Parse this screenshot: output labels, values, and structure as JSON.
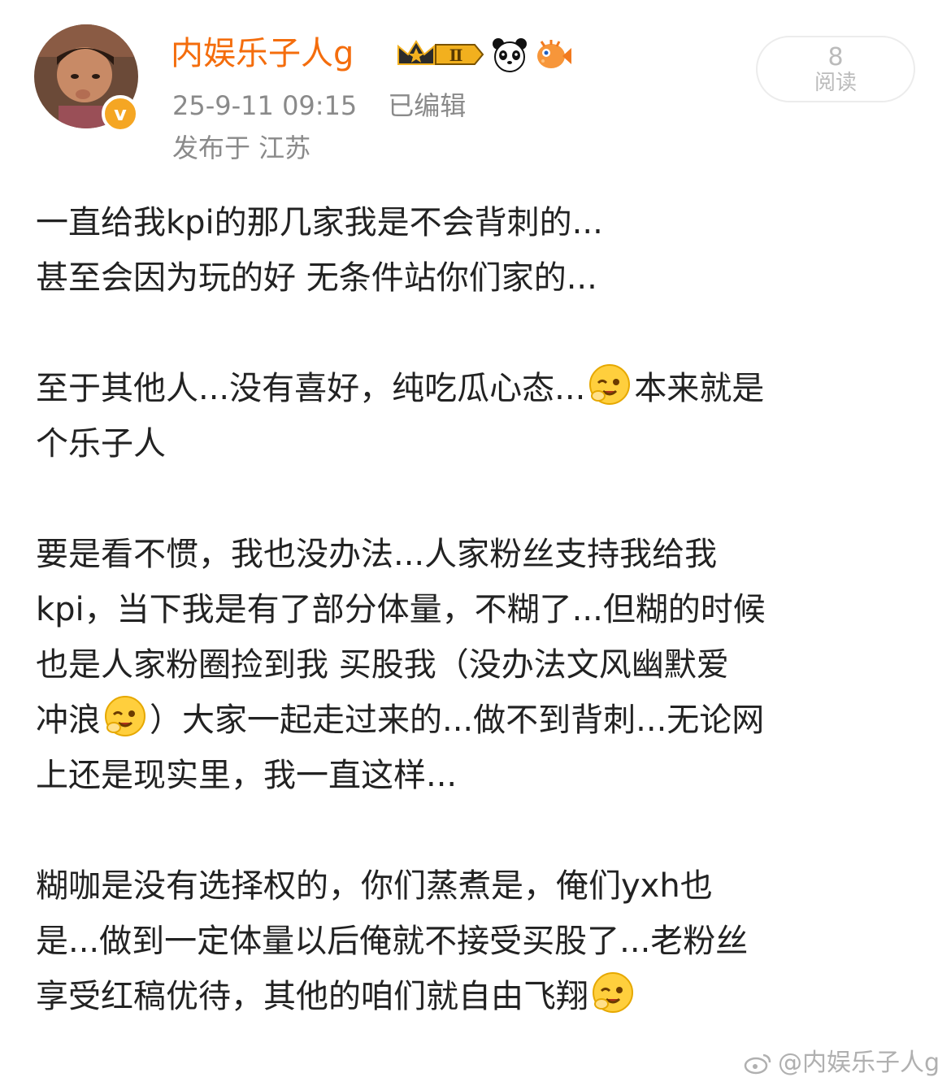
{
  "header": {
    "username": "内娱乐子人g",
    "level_badge": "Ⅱ",
    "timestamp": "25-9-11 09:15",
    "edited_label": "已编辑",
    "location": "发布于 江苏",
    "verified_mark": "v"
  },
  "reads": {
    "count": "8",
    "label": "阅读"
  },
  "post": {
    "p1_l1": "一直给我kpi的那几家我是不会背刺的...",
    "p1_l2": "甚至会因为玩的好  无条件站你们家的...",
    "p2_a": "至于其他人...没有喜好，纯吃瓜心态...",
    "p2_b": "本来就是",
    "p2_c": "个乐子人",
    "p3_l1": "要是看不惯，我也没办法...人家粉丝支持我给我",
    "p3_l2": "kpi，当下我是有了部分体量，不糊了...但糊的时候",
    "p3_l3": "也是人家粉圈捡到我 买股我（没办法文风幽默爱",
    "p3_l4a": "冲浪",
    "p3_l4b": "）大家一起走过来的...做不到背刺...无论网",
    "p3_l5": "上还是现实里，我一直这样...",
    "p4_l1": "糊咖是没有选择权的，你们蒸煮是，俺们yxh也",
    "p4_l2": "是...做到一定体量以后俺就不接受买股了...老粉丝",
    "p4_l3": "享受红稿优待，其他的咱们就自由飞翔"
  },
  "watermark": "@内娱乐子人g"
}
